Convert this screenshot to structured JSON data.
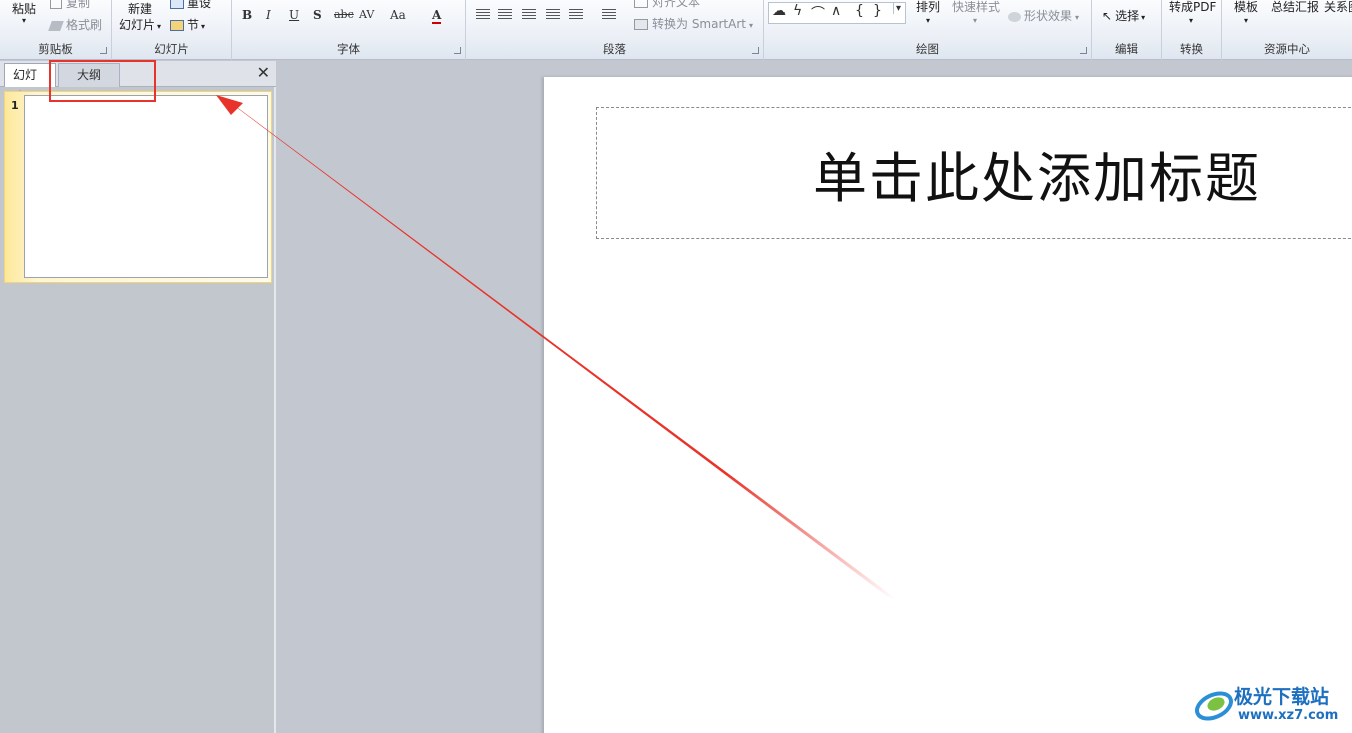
{
  "ribbon": {
    "clipboard": {
      "paste": "粘贴",
      "copy": "复制",
      "format_painter": "格式刷",
      "label": "剪贴板"
    },
    "slides": {
      "new_slide_line1": "新建",
      "new_slide_line2": "幻灯片",
      "reset": "重设",
      "section": "节",
      "label": "幻灯片"
    },
    "font": {
      "bold": "B",
      "italic": "I",
      "underline": "U",
      "shadow": "S",
      "strike": "abc",
      "spacing": "AV",
      "case": "Aa",
      "color": "A",
      "label": "字体"
    },
    "paragraph": {
      "text_direction": "对齐文本",
      "smartart": "转换为 SmartArt",
      "label": "段落"
    },
    "drawing": {
      "arrange": "排列",
      "quick_styles": "快速样式",
      "shape_effects": "形状效果",
      "label": "绘图"
    },
    "editing": {
      "select": "选择",
      "label": "编辑"
    },
    "convert": {
      "to_pdf": "转成PDF",
      "label": "转换"
    },
    "resources": {
      "template": "模板",
      "summary": "总结汇报",
      "relation": "关系图",
      "label": "资源中心"
    }
  },
  "panel": {
    "tabs": [
      {
        "label": "幻灯片",
        "active": true
      },
      {
        "label": "大纲",
        "active": false
      }
    ],
    "close_symbol": "✕",
    "slides": [
      {
        "number": "1"
      }
    ]
  },
  "slide": {
    "title_placeholder": "单击此处添加标题"
  },
  "watermark": {
    "main": "极光下载站",
    "sub": "www.xz7.com"
  },
  "colors": {
    "annotation": "#e8332a",
    "watermark": "#1d6fbf",
    "thumb_highlight": "#fde89a"
  }
}
